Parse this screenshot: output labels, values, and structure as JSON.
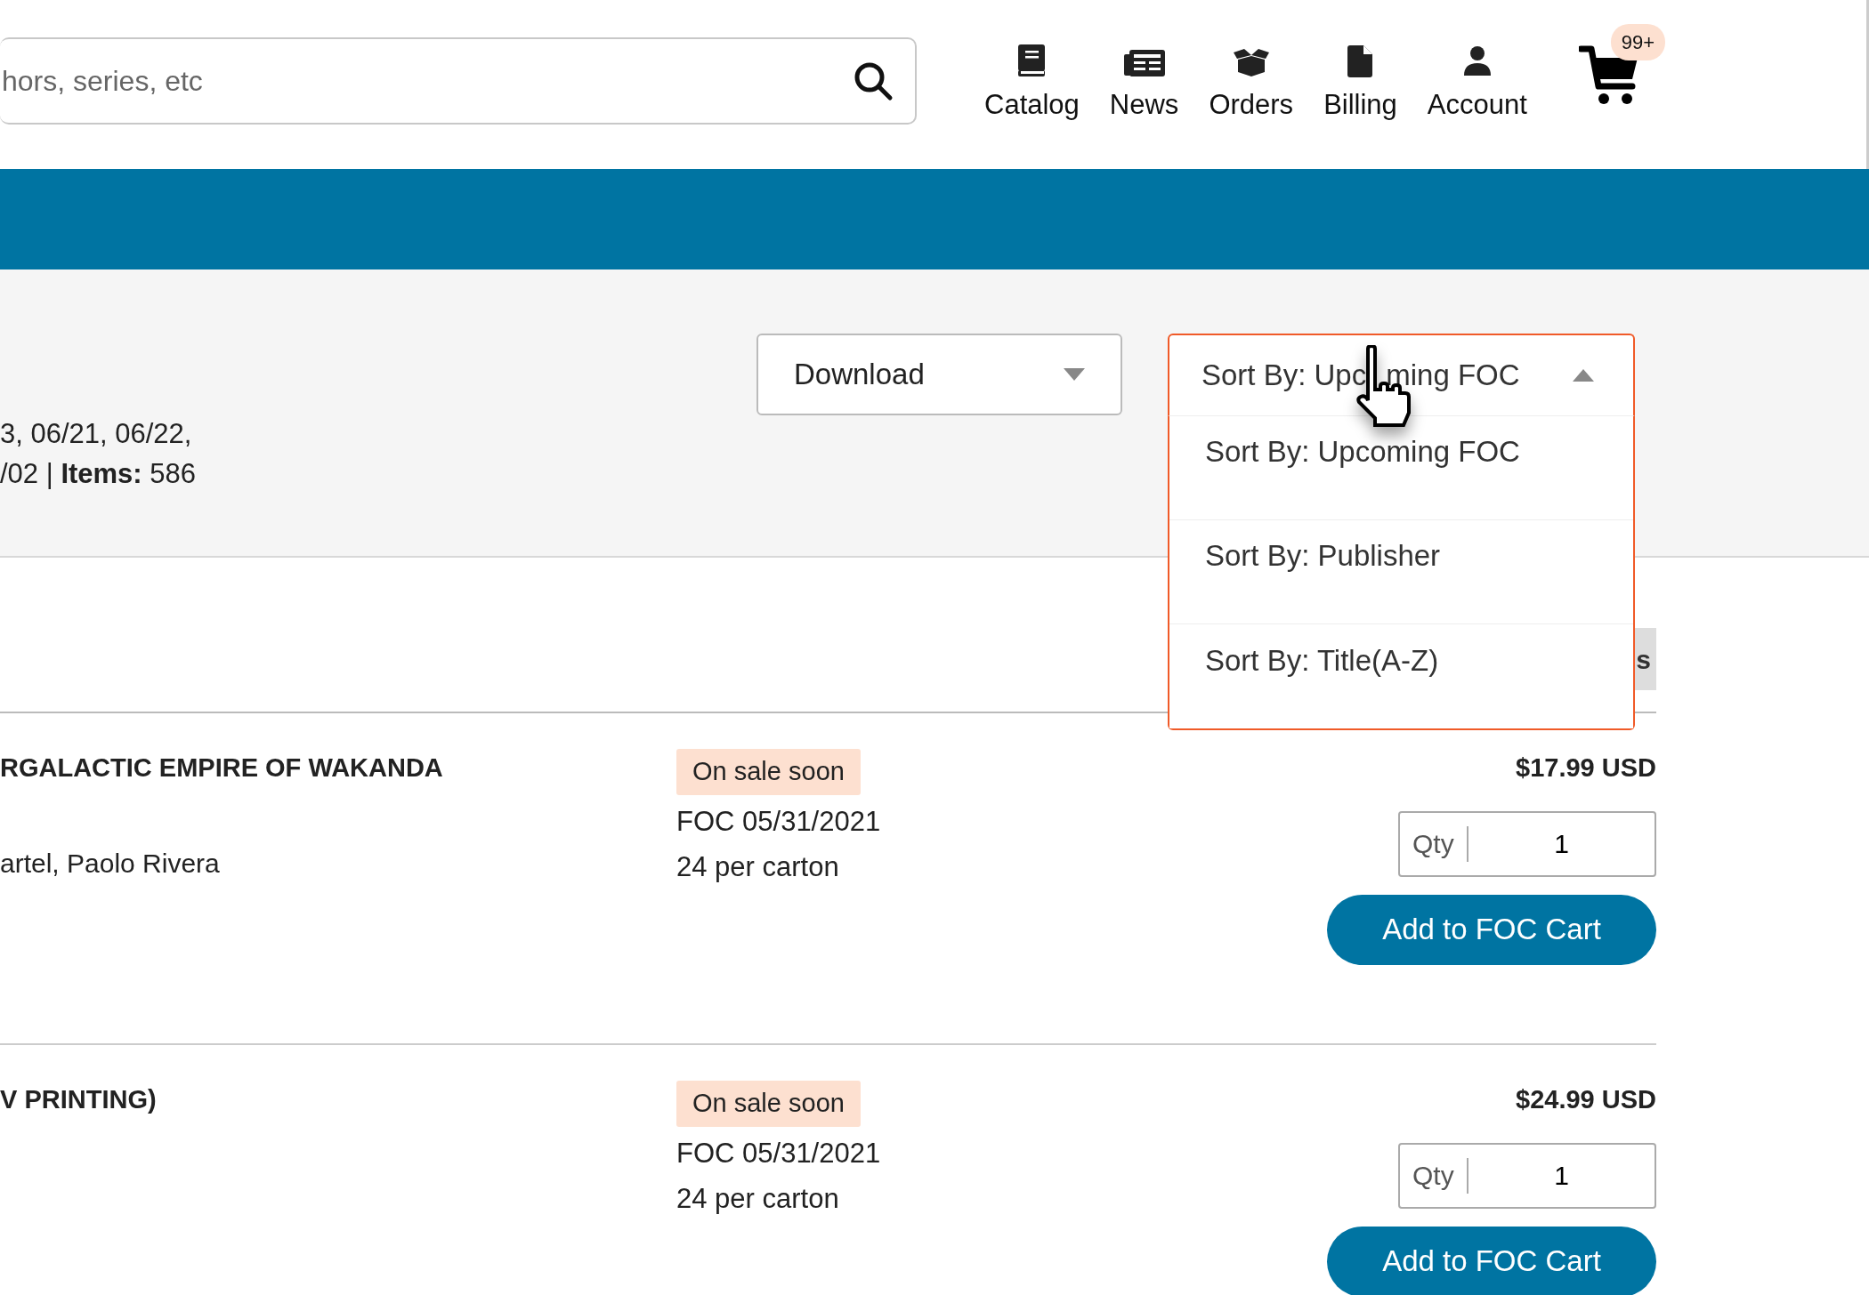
{
  "search": {
    "placeholder": "hors, series, etc"
  },
  "nav": [
    {
      "label": "Catalog",
      "kind": "book"
    },
    {
      "label": "News",
      "kind": "news"
    },
    {
      "label": "Orders",
      "kind": "box"
    },
    {
      "label": "Billing",
      "kind": "file"
    },
    {
      "label": "Account",
      "kind": "person"
    }
  ],
  "cart": {
    "badge": "99+"
  },
  "summary": {
    "lines": [
      "3, 06/21, 06/22,",
      "/02 | **Items:** 586"
    ]
  },
  "download": {
    "label": "Download"
  },
  "sort": {
    "label_parts": [
      "Sort By: Upc",
      "ming FOC"
    ],
    "expanded": true,
    "options": [
      {
        "label": "Sort By: Upcoming FOC"
      },
      {
        "label": "Sort By: Publisher"
      },
      {
        "label": "Sort By: Title(A-Z)"
      }
    ]
  },
  "partial_button": {
    "label": "s"
  },
  "products": [
    {
      "title": "RGALACTIC EMPIRE OF WAKANDA",
      "creators": "artel, Paolo Rivera",
      "badge": "On sale soon",
      "foc": "FOC 05/31/2021",
      "carton": "24 per carton",
      "price": "$17.99 USD",
      "qty_label": "Qty",
      "qty": "1",
      "button": "Add to FOC Cart"
    },
    {
      "title": "V PRINTING)",
      "badge": "On sale soon",
      "foc": "FOC 05/31/2021",
      "carton": "24 per carton",
      "price": "$24.99 USD",
      "qty_label": "Qty",
      "qty": "1",
      "button": "Add to FOC Cart"
    }
  ]
}
